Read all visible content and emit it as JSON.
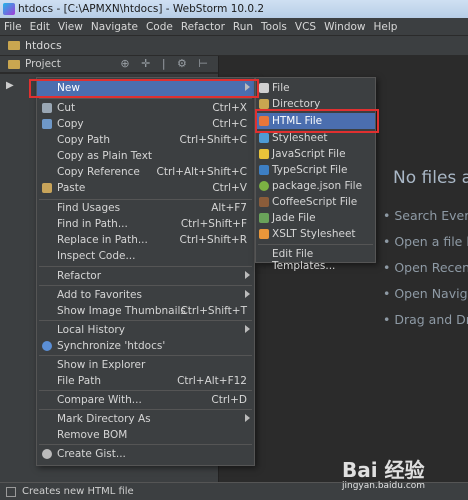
{
  "window": {
    "title": "htdocs - [C:\\APMXN\\htdocs] - WebStorm 10.0.2"
  },
  "menubar": [
    "File",
    "Edit",
    "View",
    "Navigate",
    "Code",
    "Refactor",
    "Run",
    "Tools",
    "VCS",
    "Window",
    "Help"
  ],
  "navbar": {
    "folder": "htdocs"
  },
  "project_panel": {
    "title": "Project",
    "tool_icons": "⊕ ✛ | ⚙ ⊢"
  },
  "editor": {
    "empty_title": "No files a",
    "hints": [
      "• Search Every",
      "• Open a file b",
      "• Open Recen",
      "• Open Navig",
      "• Drag and Dr"
    ]
  },
  "context_menu": {
    "items": [
      {
        "label": "New",
        "shortcut": "",
        "submenu": true,
        "selected": true
      },
      {
        "label": "Cut",
        "shortcut": "Ctrl+X",
        "icon": "cut-icon"
      },
      {
        "label": "Copy",
        "shortcut": "Ctrl+C",
        "icon": "copy-icon"
      },
      {
        "label": "Copy Path",
        "shortcut": "Ctrl+Shift+C"
      },
      {
        "label": "Copy as Plain Text",
        "shortcut": ""
      },
      {
        "label": "Copy Reference",
        "shortcut": "Ctrl+Alt+Shift+C"
      },
      {
        "label": "Paste",
        "shortcut": "Ctrl+V",
        "icon": "paste-icon"
      },
      {
        "label": "Find Usages",
        "shortcut": "Alt+F7"
      },
      {
        "label": "Find in Path...",
        "shortcut": "Ctrl+Shift+F"
      },
      {
        "label": "Replace in Path...",
        "shortcut": "Ctrl+Shift+R"
      },
      {
        "label": "Inspect Code...",
        "shortcut": ""
      },
      {
        "label": "Refactor",
        "submenu": true
      },
      {
        "label": "Add to Favorites",
        "submenu": true
      },
      {
        "label": "Show Image Thumbnails",
        "shortcut": "Ctrl+Shift+T"
      },
      {
        "label": "Local History",
        "submenu": true
      },
      {
        "label": "Synchronize 'htdocs'",
        "icon": "sync-icon"
      },
      {
        "label": "Show in Explorer",
        "shortcut": ""
      },
      {
        "label": "File Path",
        "shortcut": "Ctrl+Alt+F12"
      },
      {
        "label": "Compare With...",
        "shortcut": "Ctrl+D"
      },
      {
        "label": "Mark Directory As",
        "submenu": true
      },
      {
        "label": "Remove BOM",
        "shortcut": ""
      },
      {
        "label": "Create Gist...",
        "icon": "github-icon"
      }
    ]
  },
  "new_submenu": {
    "items": [
      {
        "label": "File",
        "icon": "file-icon"
      },
      {
        "label": "Directory",
        "icon": "folder-icon"
      },
      {
        "label": "HTML File",
        "icon": "html-icon",
        "selected": true
      },
      {
        "label": "Stylesheet",
        "icon": "css-icon"
      },
      {
        "label": "JavaScript File",
        "icon": "js-icon"
      },
      {
        "label": "TypeScript File",
        "icon": "ts-icon"
      },
      {
        "label": "package.json File",
        "icon": "npm-icon"
      },
      {
        "label": "CoffeeScript File",
        "icon": "coffee-icon"
      },
      {
        "label": "Jade File",
        "icon": "jade-icon"
      },
      {
        "label": "XSLT Stylesheet",
        "icon": "xslt-icon"
      },
      {
        "label": "Edit File Templates...",
        "icon": ""
      }
    ]
  },
  "status": "Creates new HTML file",
  "watermark": {
    "brand": "Bai 经验",
    "site": "jingyan.baidu.com"
  },
  "colors": {
    "selection": "#4b6eaf",
    "highlight_box": "#e03030",
    "panel": "#3c3f41",
    "editor": "#2b2b2b"
  }
}
